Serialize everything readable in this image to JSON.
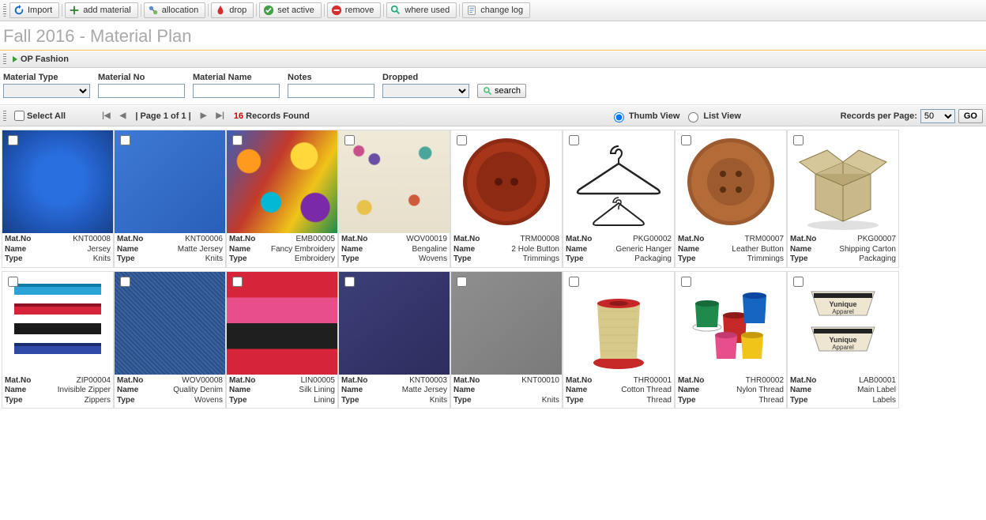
{
  "toolbar": {
    "import": "Import",
    "add_material": "add material",
    "allocation": "allocation",
    "drop": "drop",
    "set_active": "set active",
    "remove": "remove",
    "where_used": "where used",
    "change_log": "change log"
  },
  "title": "Fall 2016 - Material Plan",
  "breadcrumb": "OP Fashion",
  "filters": {
    "material_type": "Material Type",
    "material_no": "Material No",
    "material_name": "Material Name",
    "notes": "Notes",
    "dropped": "Dropped",
    "search": "search"
  },
  "pager": {
    "select_all": "Select All",
    "page_text": "|  Page 1 of 1  |",
    "records_count": "16",
    "records_found": "Records Found",
    "thumb_view": "Thumb View",
    "list_view": "List View",
    "records_per_page": "Records per Page:",
    "rpp_value": "50",
    "go": "GO"
  },
  "labels": {
    "matno": "Mat.No",
    "name": "Name",
    "type": "Type"
  },
  "materials": [
    {
      "matno": "KNT00008",
      "name": "Jersey",
      "type": "Knits",
      "img": "sw-blue-jersey"
    },
    {
      "matno": "KNT00006",
      "name": "Matte Jersey",
      "type": "Knits",
      "img": "sw-blue-plain"
    },
    {
      "matno": "EMB00005",
      "name": "Fancy Embroidery",
      "type": "Embroidery",
      "img": "sw-abstract"
    },
    {
      "matno": "WOV00019",
      "name": "Bengaline",
      "type": "Wovens",
      "img": "sw-pattern"
    },
    {
      "matno": "TRM00008",
      "name": "2 Hole Button",
      "type": "Trimmings",
      "img": "svg-button2"
    },
    {
      "matno": "PKG00002",
      "name": "Generic Hanger",
      "type": "Packaging",
      "img": "svg-hanger"
    },
    {
      "matno": "TRM00007",
      "name": "Leather Button",
      "type": "Trimmings",
      "img": "svg-button4"
    },
    {
      "matno": "PKG00007",
      "name": "Shipping Carton",
      "type": "Packaging",
      "img": "svg-box"
    },
    {
      "matno": "ZIP00004",
      "name": "Invisible Zipper",
      "type": "Zippers",
      "img": "svg-zipper"
    },
    {
      "matno": "WOV00008",
      "name": "Quality Denim",
      "type": "Wovens",
      "img": "sw-denim"
    },
    {
      "matno": "LIN00005",
      "name": "Silk Lining",
      "type": "Lining",
      "img": "sw-lining"
    },
    {
      "matno": "KNT00003",
      "name": "Matte Jersey",
      "type": "Knits",
      "img": "sw-navy"
    },
    {
      "matno": "KNT00010",
      "name": "",
      "type": "Knits",
      "img": "sw-grey"
    },
    {
      "matno": "THR00001",
      "name": "Cotton Thread",
      "type": "Thread",
      "img": "svg-thread1"
    },
    {
      "matno": "THR00002",
      "name": "Nylon Thread",
      "type": "Thread",
      "img": "svg-thread2"
    },
    {
      "matno": "LAB00001",
      "name": "Main Label",
      "type": "Labels",
      "img": "svg-label"
    }
  ]
}
